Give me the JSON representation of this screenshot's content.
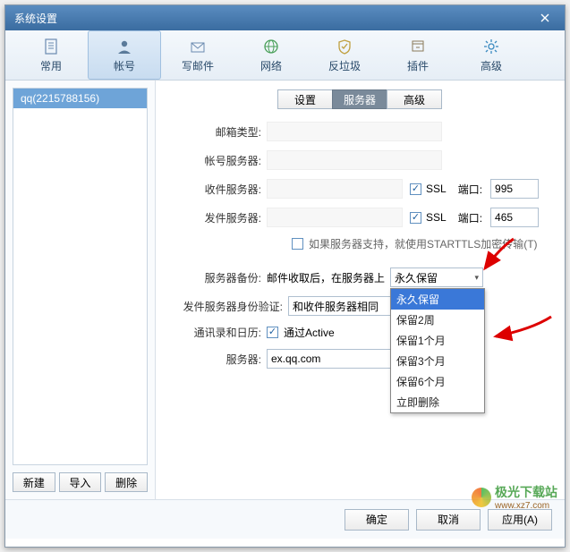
{
  "window": {
    "title": "系统设置"
  },
  "toolbar": [
    {
      "key": "common",
      "label": "常用"
    },
    {
      "key": "account",
      "label": "帐号"
    },
    {
      "key": "compose",
      "label": "写邮件"
    },
    {
      "key": "network",
      "label": "网络"
    },
    {
      "key": "antispam",
      "label": "反垃圾"
    },
    {
      "key": "plugin",
      "label": "插件"
    },
    {
      "key": "advanced",
      "label": "高级"
    }
  ],
  "sidebar": {
    "accounts": [
      {
        "label": "qq(2215788156)"
      }
    ],
    "btn_new": "新建",
    "btn_import": "导入",
    "btn_delete": "删除"
  },
  "subtabs": {
    "settings": "设置",
    "server": "服务器",
    "advanced": "高级"
  },
  "form": {
    "mailbox_type_label": "邮箱类型:",
    "account_server_label": "帐号服务器:",
    "incoming_label": "收件服务器:",
    "outgoing_label": "发件服务器:",
    "ssl": "SSL",
    "port": "端口:",
    "port_in": "995",
    "port_out": "465",
    "starttls": "如果服务器支持，就使用STARTTLS加密传输(T)",
    "backup_label": "服务器备份:",
    "backup_prefix": "邮件收取后，在服务器上",
    "backup_value": "永久保留",
    "backup_options": [
      "永久保留",
      "保留2周",
      "保留1个月",
      "保留3个月",
      "保留6个月",
      "立即删除"
    ],
    "auth_label": "发件服务器身份验证:",
    "auth_value": "和收件服务器相同",
    "sync_label": "通讯录和日历:",
    "sync_text": "通过Active",
    "server_label": "服务器:",
    "server_value": "ex.qq.com"
  },
  "footer": {
    "ok": "确定",
    "cancel": "取消",
    "apply": "应用(A)"
  },
  "watermark": {
    "name": "极光下载站",
    "url": "www.xz7.com"
  }
}
